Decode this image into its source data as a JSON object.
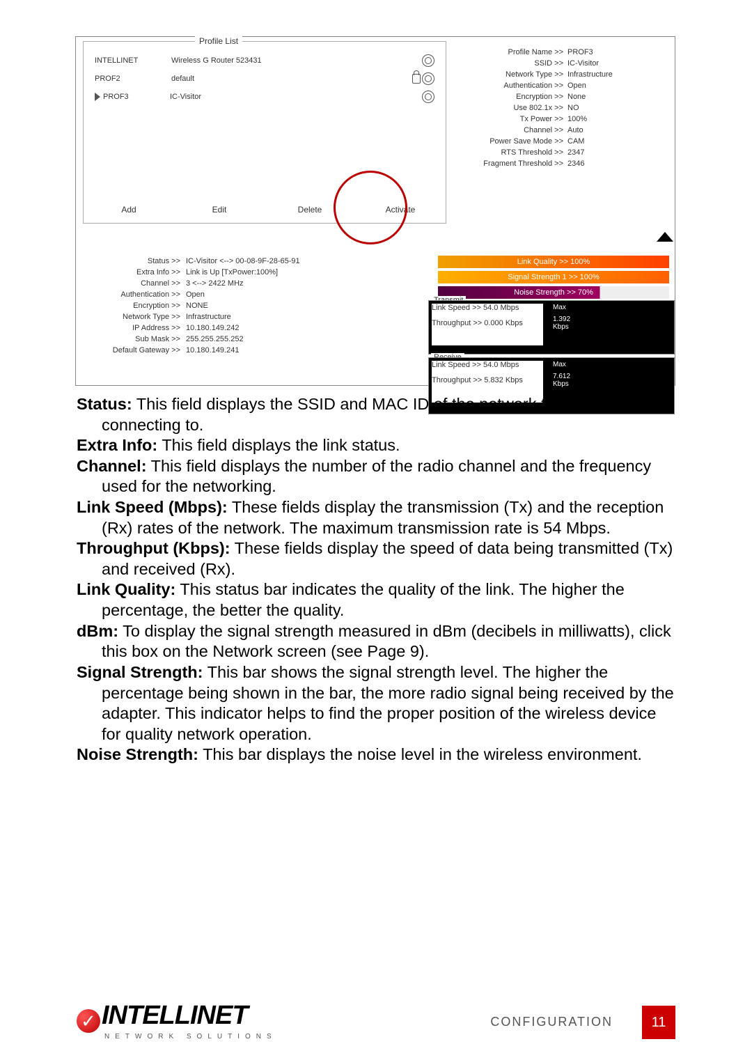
{
  "profile_list": {
    "title": "Profile List",
    "items": [
      {
        "name": "INTELLINET",
        "ssid": "Wireless G Router 523431",
        "locked": false,
        "selected": false
      },
      {
        "name": "PROF2",
        "ssid": "default",
        "locked": true,
        "selected": false
      },
      {
        "name": "PROF3",
        "ssid": "IC-Visitor",
        "locked": false,
        "selected": true
      }
    ],
    "buttons": {
      "add": "Add",
      "edit": "Edit",
      "delete": "Delete",
      "activate": "Activate"
    }
  },
  "profile_detail": {
    "rows": [
      {
        "label": "Profile Name >>",
        "value": "PROF3"
      },
      {
        "label": "SSID >>",
        "value": "IC-Visitor"
      },
      {
        "label": "Network Type >>",
        "value": "Infrastructure"
      },
      {
        "label": "Authentication >>",
        "value": "Open"
      },
      {
        "label": "Encryption >>",
        "value": "None"
      },
      {
        "label": "Use 802.1x >>",
        "value": "NO"
      },
      {
        "label": "Tx Power >>",
        "value": "100%"
      },
      {
        "label": "Channel >>",
        "value": "Auto"
      },
      {
        "label": "Power Save Mode >>",
        "value": "CAM"
      },
      {
        "label": "RTS Threshold >>",
        "value": "2347"
      },
      {
        "label": "Fragment Threshold >>",
        "value": "2346"
      }
    ]
  },
  "status_info": {
    "rows": [
      {
        "label": "Status >>",
        "value": "IC-Visitor <--> 00-08-9F-28-65-91"
      },
      {
        "label": "Extra Info >>",
        "value": "Link is Up [TxPower:100%]"
      },
      {
        "label": "Channel >>",
        "value": "3 <--> 2422 MHz"
      },
      {
        "label": "Authentication >>",
        "value": "Open"
      },
      {
        "label": "Encryption >>",
        "value": "NONE"
      },
      {
        "label": "Network Type >>",
        "value": "Infrastructure"
      },
      {
        "label": "IP Address >>",
        "value": "10.180.149.242"
      },
      {
        "label": "Sub Mask >>",
        "value": "255.255.255.252"
      },
      {
        "label": "Default Gateway >>",
        "value": "10.180.149.241"
      }
    ]
  },
  "bars": {
    "lq": "Link Quality >> 100%",
    "ss": "Signal Strength 1 >> 100%",
    "ns": "Noise Strength >> 70%"
  },
  "transmit": {
    "title": "Transmit",
    "link_speed_label": "Link Speed >>",
    "link_speed": "54.0 Mbps",
    "throughput_label": "Throughput >>",
    "throughput": "0.000 Kbps",
    "max_label": "Max",
    "max": "1.392",
    "unit": "Kbps"
  },
  "receive": {
    "title": "Receive",
    "link_speed_label": "Link Speed >>",
    "link_speed": "54.0 Mbps",
    "throughput_label": "Throughput >>",
    "throughput": "5.832 Kbps",
    "max_label": "Max",
    "max": "7.612",
    "unit": "Kbps"
  },
  "body": {
    "p1a": "Status:",
    "p1b": " This field displays the SSID and MAC ID of the network the adapter is connecting to.",
    "p2a": "Extra Info:",
    "p2b": " This field displays the link status.",
    "p3a": "Channel:",
    "p3b": " This field displays the number of the radio channel and the frequency used for the networking.",
    "p4a": "Link Speed (Mbps):",
    "p4b": " These fields display the transmission (Tx) and the reception (Rx) rates of the network. The maximum transmission rate is 54 Mbps.",
    "p5a": "Throughput (Kbps):",
    "p5b": " These fields display the speed of data being transmitted (Tx) and received (Rx).",
    "p6a": " Link Quality:",
    "p6b": " This status bar indicates the quality of the link. The higher the percentage, the better the quality.",
    "p7a": " dBm:",
    "p7b": "  To display the signal strength measured in dBm (decibels in milliwatts), click this box on the Network screen (see Page 9).",
    "p8a": "Signal Strength:",
    "p8b": " This bar shows the signal strength level. The higher the percentage being shown in the bar, the more radio signal being received by the adapter. This indicator helps to find the proper position of the wireless device for quality network operation.",
    "p9a": "Noise Strength:",
    "p9b": " This bar displays the noise level in the wireless environment."
  },
  "footer": {
    "logo_main": "INTELLINET",
    "logo_sub": "NETWORK SOLUTIONS",
    "section": "CONFIGURATION",
    "page": "11"
  }
}
